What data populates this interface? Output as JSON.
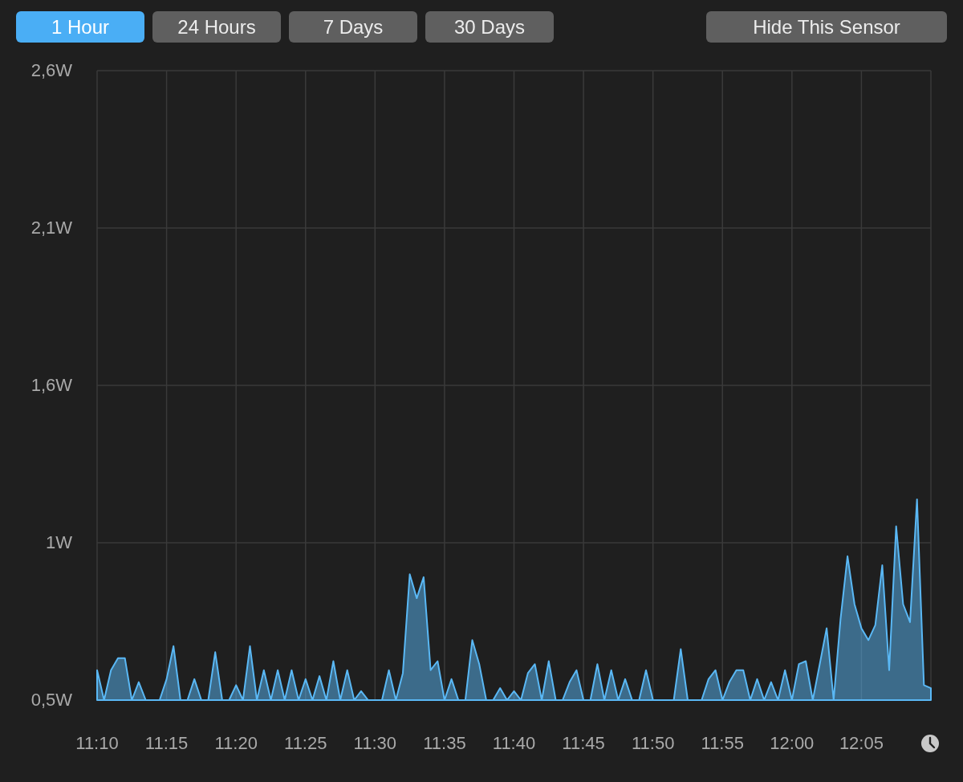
{
  "range_tabs": [
    {
      "label": "1 Hour",
      "selected": true
    },
    {
      "label": "24 Hours",
      "selected": false
    },
    {
      "label": "7 Days",
      "selected": false
    },
    {
      "label": "30 Days",
      "selected": false
    }
  ],
  "hide_button": {
    "label": "Hide This Sensor"
  },
  "chart_data": {
    "type": "area",
    "grid": true,
    "ylim": [
      0.5,
      2.6
    ],
    "yticks": [
      {
        "value": 0.5,
        "label": "0,5W"
      },
      {
        "value": 1.025,
        "label": "1W"
      },
      {
        "value": 1.55,
        "label": "1,6W"
      },
      {
        "value": 2.075,
        "label": "2,1W"
      },
      {
        "value": 2.6,
        "label": "2,6W"
      }
    ],
    "categories": [
      "11:10",
      null,
      null,
      null,
      null,
      null,
      null,
      null,
      null,
      null,
      "11:15",
      null,
      null,
      null,
      null,
      null,
      null,
      null,
      null,
      null,
      "11:20",
      null,
      null,
      null,
      null,
      null,
      null,
      null,
      null,
      null,
      "11:25",
      null,
      null,
      null,
      null,
      null,
      null,
      null,
      null,
      null,
      "11:30",
      null,
      null,
      null,
      null,
      null,
      null,
      null,
      null,
      null,
      "11:35",
      null,
      null,
      null,
      null,
      null,
      null,
      null,
      null,
      null,
      "11:40",
      null,
      null,
      null,
      null,
      null,
      null,
      null,
      null,
      null,
      "11:45",
      null,
      null,
      null,
      null,
      null,
      null,
      null,
      null,
      null,
      "11:50",
      null,
      null,
      null,
      null,
      null,
      null,
      null,
      null,
      null,
      "11:55",
      null,
      null,
      null,
      null,
      null,
      null,
      null,
      null,
      null,
      "12:00",
      null,
      null,
      null,
      null,
      null,
      null,
      null,
      null,
      null,
      "12:05",
      null,
      null,
      null,
      null,
      null,
      null,
      null,
      null,
      null,
      null
    ],
    "series": [
      {
        "color": "#5ab8f5",
        "values": [
          0.6,
          0.5,
          0.6,
          0.64,
          0.64,
          0.5,
          0.56,
          0.5,
          0.5,
          0.5,
          0.57,
          0.68,
          0.5,
          0.5,
          0.57,
          0.5,
          0.5,
          0.66,
          0.5,
          0.5,
          0.55,
          0.5,
          0.68,
          0.5,
          0.6,
          0.5,
          0.6,
          0.5,
          0.6,
          0.5,
          0.57,
          0.5,
          0.58,
          0.5,
          0.63,
          0.5,
          0.6,
          0.5,
          0.53,
          0.5,
          0.5,
          0.5,
          0.6,
          0.5,
          0.59,
          0.92,
          0.84,
          0.91,
          0.6,
          0.63,
          0.5,
          0.57,
          0.5,
          0.5,
          0.7,
          0.62,
          0.5,
          0.5,
          0.54,
          0.5,
          0.53,
          0.5,
          0.59,
          0.62,
          0.5,
          0.63,
          0.5,
          0.5,
          0.56,
          0.6,
          0.5,
          0.5,
          0.62,
          0.5,
          0.6,
          0.5,
          0.57,
          0.5,
          0.5,
          0.6,
          0.5,
          0.5,
          0.5,
          0.5,
          0.67,
          0.5,
          0.5,
          0.5,
          0.57,
          0.6,
          0.5,
          0.56,
          0.6,
          0.6,
          0.5,
          0.57,
          0.5,
          0.56,
          0.5,
          0.6,
          0.5,
          0.62,
          0.63,
          0.5,
          0.62,
          0.74,
          0.5,
          0.77,
          0.98,
          0.82,
          0.74,
          0.7,
          0.75,
          0.95,
          0.6,
          1.08,
          0.82,
          0.76,
          1.17,
          0.55,
          0.54
        ]
      }
    ]
  }
}
